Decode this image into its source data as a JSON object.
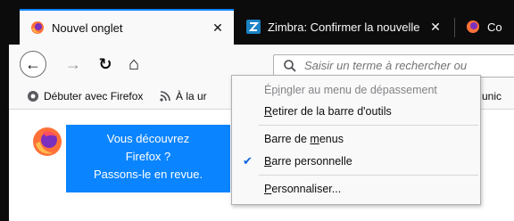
{
  "tabs": [
    {
      "title": "Nouvel onglet",
      "active": true,
      "close": "✕"
    },
    {
      "title": "Zimbra: Confirmer la nouvelle",
      "active": false,
      "close": "✕"
    },
    {
      "title": "Co",
      "active": false
    }
  ],
  "navbar": {
    "back_icon": "←",
    "forward_icon": "→",
    "reload_icon": "↻",
    "home_icon": "⌂",
    "url_placeholder": "Saisir un terme à rechercher ou"
  },
  "bookmarks": [
    {
      "label": "Débuter avec Firefox",
      "icon": "gear-icon"
    },
    {
      "label": "À la ur",
      "icon": "rss-icon"
    },
    {
      "label": "unic",
      "icon": "folder-icon"
    }
  ],
  "callout": {
    "line1": "Vous découvrez",
    "line2": "Firefox ?",
    "line3": "Passons-le en revue."
  },
  "context_menu": {
    "item1": {
      "pre": "Ép",
      "acc": "i",
      "post": "ngler au menu de dépassement"
    },
    "item2": {
      "pre": "",
      "acc": "R",
      "post": "etirer de la barre d'outils"
    },
    "item3": {
      "pre": "Barre de ",
      "acc": "m",
      "post": "enus"
    },
    "item4": {
      "pre": "",
      "acc": "B",
      "post": "arre personnelle"
    },
    "item5": {
      "pre": "",
      "acc": "P",
      "post": "ersonnaliser..."
    },
    "check": "✔"
  },
  "colors": {
    "accent": "#0a84ff",
    "frame": "#0c0c0d",
    "toolbar": "#f9f9fa"
  }
}
